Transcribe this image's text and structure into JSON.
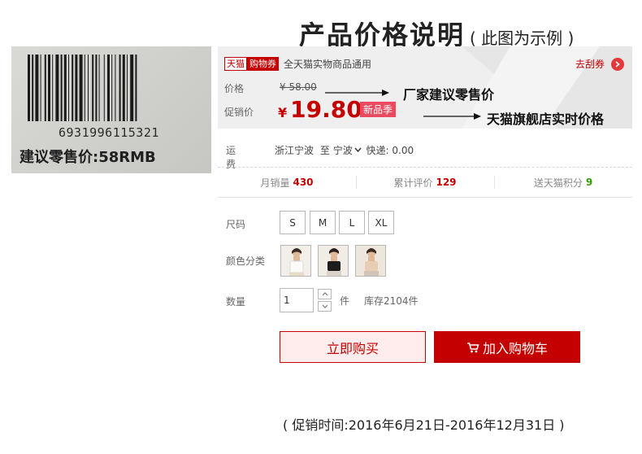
{
  "header": {
    "title": "产品价格说明",
    "subtitle": "( 此图为示例 )"
  },
  "barcode_photo": {
    "barcode_number": "6931996115321",
    "retail_label": "建议零售价:58RMB"
  },
  "promo_box": {
    "tmall_tag": "天猫",
    "coupon_tag": "购物券",
    "coupon_desc": "全天猫实物商品通用",
    "get_coupon": "去刮券",
    "price_label": "价格",
    "original_price": "¥ 58.00",
    "promo_label": "促销价",
    "currency": "¥",
    "promo_amount": "19.80",
    "new_tag": "新品季"
  },
  "annotations": {
    "suggested": "厂家建议零售价",
    "realtime": "天猫旗舰店实时价格"
  },
  "shipping": {
    "label": "运费",
    "from": "浙江宁波",
    "to_word": "至",
    "to": "宁波",
    "express": "快递: 0.00"
  },
  "stats": {
    "monthly_sales": {
      "label": "月销量",
      "value": "430"
    },
    "reviews": {
      "label": "累计评价",
      "value": "129"
    },
    "points": {
      "label": "送天猫积分",
      "value": "9"
    }
  },
  "options": {
    "size_label": "尺码",
    "sizes": [
      "S",
      "M",
      "L",
      "XL"
    ],
    "color_label": "颜色分类",
    "quantity_label": "数量",
    "quantity": "1",
    "unit": "件",
    "stock": "库存2104件"
  },
  "actions": {
    "buy_now": "立即购买",
    "add_cart": "加入购物车"
  },
  "promo_period": "( 促销时间:2016年6月21日-2016年12月31日 )",
  "colors": {
    "brand_red": "#c40000",
    "tag_pink": "#ea4960"
  },
  "icons": [
    "chevron-right-icon",
    "arrow-icon",
    "chevron-down-icon",
    "cart-icon"
  ]
}
